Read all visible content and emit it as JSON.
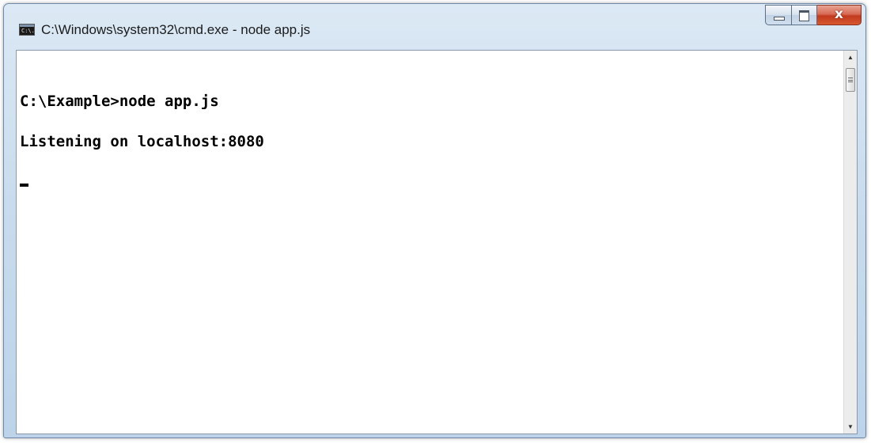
{
  "window": {
    "title": "C:\\Windows\\system32\\cmd.exe - node  app.js",
    "icon": "command-prompt-icon",
    "icon_text": "C:\\."
  },
  "caption_buttons": {
    "minimize": "minimize-icon",
    "maximize": "maximize-icon",
    "close_glyph": "x"
  },
  "console": {
    "lines": [
      "C:\\Example>node app.js",
      "Listening on localhost:8080"
    ],
    "text_color": "#000000",
    "background_color": "#ffffff"
  },
  "scrollbar": {
    "up_arrow": "▲",
    "down_arrow": "▼"
  }
}
